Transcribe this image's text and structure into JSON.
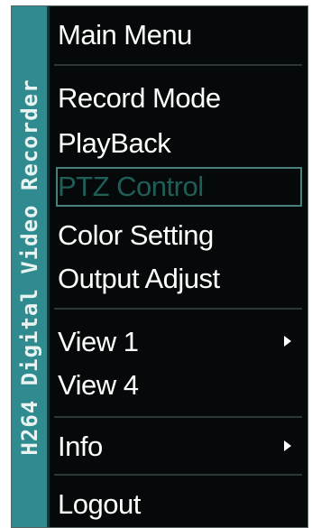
{
  "banner": {
    "text": "H264 Digital Video Recorder"
  },
  "menu": {
    "title": "Main Menu",
    "items": [
      {
        "label": "Record Mode",
        "selected": false,
        "submenu": false
      },
      {
        "label": "PlayBack",
        "selected": false,
        "submenu": false
      },
      {
        "label": "PTZ Control",
        "selected": true,
        "submenu": false
      },
      {
        "label": "Color Setting",
        "selected": false,
        "submenu": false
      },
      {
        "label": "Output Adjust",
        "selected": false,
        "submenu": false
      },
      {
        "label": "View 1",
        "selected": false,
        "submenu": true
      },
      {
        "label": "View 4",
        "selected": false,
        "submenu": false
      },
      {
        "label": "Info",
        "selected": false,
        "submenu": true
      },
      {
        "label": "Logout",
        "selected": false,
        "submenu": false
      }
    ]
  },
  "colors": {
    "background": "#060909",
    "banner": "#2f8b8f",
    "text": "#ffffff",
    "selected_text": "#1f5e58",
    "selected_border": "#4a7f7a"
  },
  "icons": {
    "submenu": "triangle-right-icon"
  }
}
